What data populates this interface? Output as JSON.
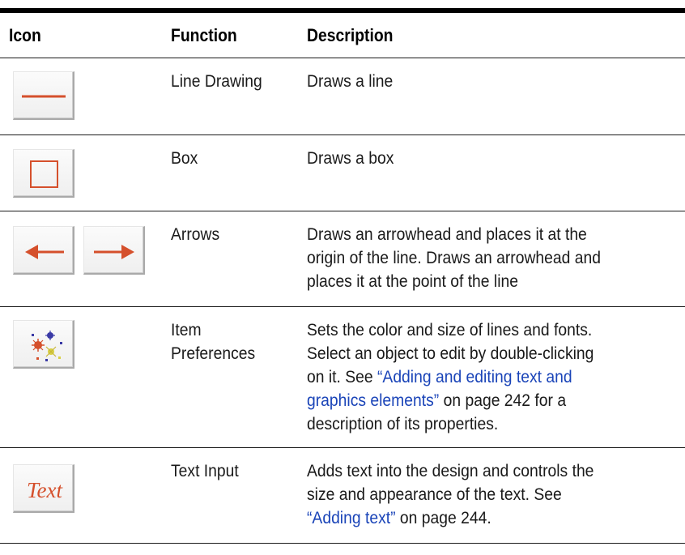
{
  "headers": {
    "icon": "Icon",
    "function": "Function",
    "description": "Description"
  },
  "rows": [
    {
      "function": "Line Drawing",
      "description": [
        "Draws a line"
      ],
      "icon": "line-icon"
    },
    {
      "function": "Box",
      "description": [
        "Draws a box"
      ],
      "icon": "box-icon"
    },
    {
      "function": "Arrows",
      "description": [
        "Draws an arrowhead and places it at the",
        "origin of the line. Draws an arrowhead and",
        "places it at the point of the line"
      ],
      "icon": "arrows-icon"
    },
    {
      "function": [
        "Item",
        "Preferences"
      ],
      "description": {
        "line1": "Sets the color and size of lines and fonts.",
        "line2": "Select an object to edit by double-clicking",
        "line3_prefix": "on it. See ",
        "line3_link": "“Adding and editing text and",
        "line4_link": "graphics elements”",
        "line4_suffix": " on page 242 for a",
        "line5": "description of its properties."
      },
      "icon": "item-preferences-icon"
    },
    {
      "function": "Text Input",
      "description": {
        "line1": "Adds text into the design and controls the",
        "line2": "size and appearance of the text. See",
        "line3_link": "“Adding text”",
        "line3_suffix": " on page 244."
      },
      "icon": "text-input-icon",
      "icon_label": "Text"
    }
  ],
  "colors": {
    "icon_glyph": "#d5502c",
    "link": "#1a44b8"
  }
}
